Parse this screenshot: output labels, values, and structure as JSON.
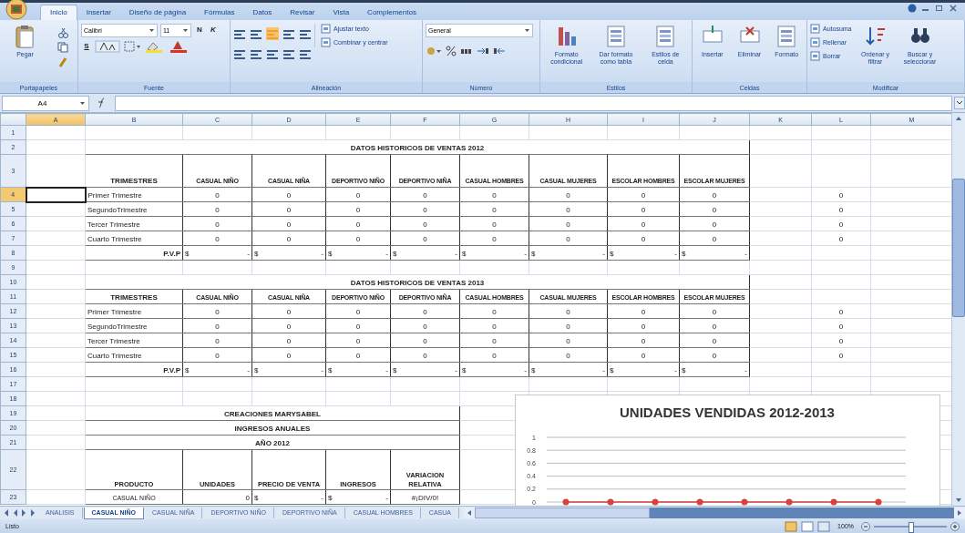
{
  "ribbon": {
    "tabs": [
      {
        "label": "Inicio",
        "selected": true
      },
      {
        "label": "Insertar",
        "selected": false
      },
      {
        "label": "Diseño de página",
        "selected": false
      },
      {
        "label": "Fórmulas",
        "selected": false
      },
      {
        "label": "Datos",
        "selected": false
      },
      {
        "label": "Revisar",
        "selected": false
      },
      {
        "label": "Vista",
        "selected": false
      },
      {
        "label": "Complementos",
        "selected": false
      }
    ],
    "groups": [
      {
        "label": "Portapapeles",
        "items": [
          {
            "kind": "large",
            "label": "Pegar"
          }
        ]
      },
      {
        "label": "Fuente",
        "items": [
          {
            "kind": "dropdown",
            "label": "Calibri"
          },
          {
            "kind": "dropdown",
            "label": "11"
          },
          {
            "kind": "toggle",
            "label": "N"
          },
          {
            "kind": "toggle",
            "label": "K"
          },
          {
            "kind": "toggle",
            "label": "S"
          }
        ]
      },
      {
        "label": "Alineación",
        "items": [
          {
            "kind": "small",
            "label": "Ajustar texto"
          },
          {
            "kind": "small",
            "label": "Combinar y centrar"
          }
        ]
      },
      {
        "label": "Número",
        "items": [
          {
            "kind": "dropdown",
            "label": "General"
          }
        ]
      },
      {
        "label": "Estilos",
        "items": [
          {
            "kind": "large",
            "label": "Formato condicional"
          },
          {
            "kind": "large",
            "label": "Dar formato como tabla"
          },
          {
            "kind": "large",
            "label": "Estilos de celda"
          }
        ]
      },
      {
        "label": "Celdas",
        "items": [
          {
            "kind": "large",
            "label": "Insertar"
          },
          {
            "kind": "large",
            "label": "Eliminar"
          },
          {
            "kind": "large",
            "label": "Formato"
          }
        ]
      },
      {
        "label": "Modificar",
        "items": [
          {
            "kind": "small",
            "label": "Autosuma"
          },
          {
            "kind": "small",
            "label": "Rellenar"
          },
          {
            "kind": "small",
            "label": "Borrar"
          },
          {
            "kind": "large",
            "label": "Ordenar y filtrar"
          },
          {
            "kind": "large",
            "label": "Buscar y seleccionar"
          }
        ]
      }
    ]
  },
  "formula_bar": {
    "name_box": "A4"
  },
  "sheet": {
    "columns": [
      {
        "label": "A",
        "selected": true
      },
      {
        "label": "B",
        "selected": false
      },
      {
        "label": "C",
        "selected": false
      },
      {
        "label": "D",
        "selected": false
      },
      {
        "label": "E",
        "selected": false
      },
      {
        "label": "F",
        "selected": false
      },
      {
        "label": "G",
        "selected": false
      },
      {
        "label": "H",
        "selected": false
      },
      {
        "label": "I",
        "selected": false
      },
      {
        "label": "J",
        "selected": false
      },
      {
        "label": "K",
        "selected": false
      },
      {
        "label": "L",
        "selected": false
      },
      {
        "label": "M",
        "selected": false
      }
    ],
    "rows": [
      {
        "label": "1",
        "selected": false
      },
      {
        "label": "2",
        "selected": false
      },
      {
        "label": "3",
        "selected": false
      },
      {
        "label": "4",
        "selected": true
      },
      {
        "label": "5",
        "selected": false
      },
      {
        "label": "6",
        "selected": false
      },
      {
        "label": "7",
        "selected": false
      },
      {
        "label": "8",
        "selected": false
      },
      {
        "label": "9",
        "selected": false
      },
      {
        "label": "10",
        "selected": false
      },
      {
        "label": "11",
        "selected": false
      },
      {
        "label": "12",
        "selected": false
      },
      {
        "label": "13",
        "selected": false
      },
      {
        "label": "14",
        "selected": false
      },
      {
        "label": "15",
        "selected": false
      },
      {
        "label": "16",
        "selected": false
      },
      {
        "label": "17",
        "selected": false
      },
      {
        "label": "18",
        "selected": false
      },
      {
        "label": "19",
        "selected": false
      },
      {
        "label": "20",
        "selected": false
      },
      {
        "label": "21",
        "selected": false
      },
      {
        "label": "22",
        "selected": false
      },
      {
        "label": "23",
        "selected": false
      }
    ],
    "sales_tables": [
      {
        "title": "DATOS HISTORICOS DE VENTAS 2012",
        "header": "TRIMESTRES",
        "columns": [
          "CASUAL NIÑO",
          "CASUAL NIÑA",
          "DEPORTIVO NIÑO",
          "DEPORTIVO NIÑA",
          "CASUAL HOMBRES",
          "CASUAL MUJERES",
          "ESCOLAR HOMBRES",
          "ESCOLAR MUJERES"
        ],
        "rows": [
          {
            "label": "Primer Trimestre",
            "values": [
              "0",
              "0",
              "0",
              "0",
              "0",
              "0",
              "0",
              "0"
            ],
            "total": "0"
          },
          {
            "label": "SegundoTrimestre",
            "values": [
              "0",
              "0",
              "0",
              "0",
              "0",
              "0",
              "0",
              "0"
            ],
            "total": "0"
          },
          {
            "label": "Tercer Trimestre",
            "values": [
              "0",
              "0",
              "0",
              "0",
              "0",
              "0",
              "0",
              "0"
            ],
            "total": "0"
          },
          {
            "label": "Cuarto Trimestre",
            "values": [
              "0",
              "0",
              "0",
              "0",
              "0",
              "0",
              "0",
              "0"
            ],
            "total": "0"
          }
        ],
        "price_row": {
          "label": "P.V.P",
          "values": [
            "$ -",
            "$ -",
            "$ -",
            "$ -",
            "$ -",
            "$ -",
            "$ -",
            "$ -"
          ]
        }
      },
      {
        "title": "DATOS HISTORICOS DE VENTAS 2013",
        "header": "TRIMESTRES",
        "columns": [
          "CASUAL NIÑO",
          "CASUAL NIÑA",
          "DEPORTIVO NIÑO",
          "DEPORTIVO NIÑA",
          "CASUAL HOMBRES",
          "CASUAL MUJERES",
          "ESCOLAR HOMBRES",
          "ESCOLAR MUJERES"
        ],
        "rows": [
          {
            "label": "Primer Trimestre",
            "values": [
              "0",
              "0",
              "0",
              "0",
              "0",
              "0",
              "0",
              "0"
            ],
            "total": "0"
          },
          {
            "label": "SegundoTrimestre",
            "values": [
              "0",
              "0",
              "0",
              "0",
              "0",
              "0",
              "0",
              "0"
            ],
            "total": "0"
          },
          {
            "label": "Tercer Trimestre",
            "values": [
              "0",
              "0",
              "0",
              "0",
              "0",
              "0",
              "0",
              "0"
            ],
            "total": "0"
          },
          {
            "label": "Cuarto Trimestre",
            "values": [
              "0",
              "0",
              "0",
              "0",
              "0",
              "0",
              "0",
              "0"
            ],
            "total": "0"
          }
        ],
        "price_row": {
          "label": "P.V.P",
          "values": [
            "$ -",
            "$ -",
            "$ -",
            "$ -",
            "$ -",
            "$ -",
            "$ -",
            "$ -"
          ]
        }
      }
    ],
    "income_table": {
      "titles": [
        "CREACIONES MARYSABEL",
        "INGRESOS ANUALES",
        "AÑO 2012"
      ],
      "columns": [
        "PRODUCTO",
        "UNIDADES",
        "PRECIO DE VENTA",
        "INGRESOS",
        "VARIACION RELATIVA"
      ],
      "rows": [
        {
          "product": "CASUAL NIÑO",
          "units": "0",
          "price": "$ -",
          "income": "$ -",
          "variation": "#¡DIV/0!"
        }
      ]
    },
    "chart": {
      "chart_data": {
        "type": "line",
        "title": "UNIDADES VENDIDAS 2012-2013",
        "grid": true,
        "ylim": [
          0,
          1
        ],
        "yticks": [
          0,
          0.2,
          0.4,
          0.6,
          0.8,
          1
        ],
        "series": [
          {
            "color": "#d9413b",
            "marker": "circle",
            "values": [
              0,
              0,
              0,
              0,
              0,
              0,
              0,
              0
            ]
          }
        ]
      }
    }
  },
  "sheet_tabs": [
    {
      "label": "ANALISIS",
      "selected": false
    },
    {
      "label": "CASUAL NIÑO",
      "selected": true
    },
    {
      "label": "CASUAL NIÑA",
      "selected": false
    },
    {
      "label": "DEPORTIVO NIÑO",
      "selected": false
    },
    {
      "label": "DEPORTIVO NIÑA",
      "selected": false
    },
    {
      "label": "CASUAL HOMBRES",
      "selected": false
    },
    {
      "label": "CASUA",
      "selected": false
    }
  ],
  "status_bar": {
    "status": "Listo",
    "zoom": {
      "label": "100%",
      "level": 0.5
    }
  }
}
